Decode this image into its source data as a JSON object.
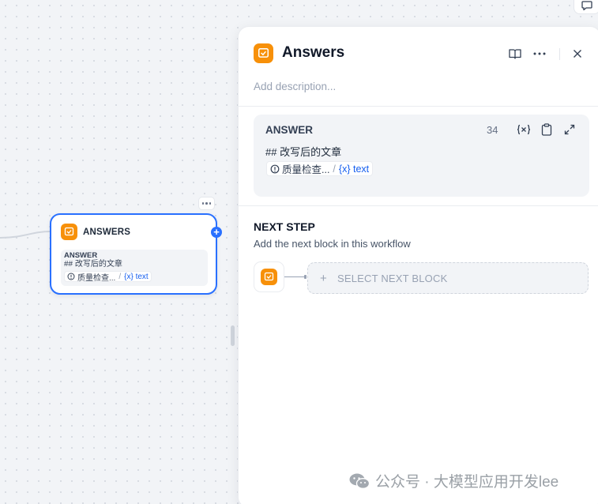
{
  "canvas": {
    "node": {
      "title": "ANSWERS",
      "body_label": "ANSWER",
      "body_text": "## 改写后的文章",
      "var_source": "质量检查...",
      "var_sep": "/",
      "var_name": "{x} text"
    }
  },
  "panel": {
    "title": "Answers",
    "description_placeholder": "Add description...",
    "answer": {
      "label": "ANSWER",
      "char_count": "34",
      "text": "## 改写后的文章",
      "var_source": "质量检查...",
      "var_sep": "/",
      "var_name": "{x} text"
    },
    "next_step": {
      "title": "NEXT STEP",
      "subtitle": "Add the next block in this workflow",
      "select_plus": "+",
      "select_label": "SELECT NEXT BLOCK"
    }
  },
  "watermark": {
    "text": "公众号 · 大模型应用开发lee"
  },
  "colors": {
    "accent": "#2970ff",
    "answer_icon": "#f79009",
    "variable": "#155eef"
  }
}
